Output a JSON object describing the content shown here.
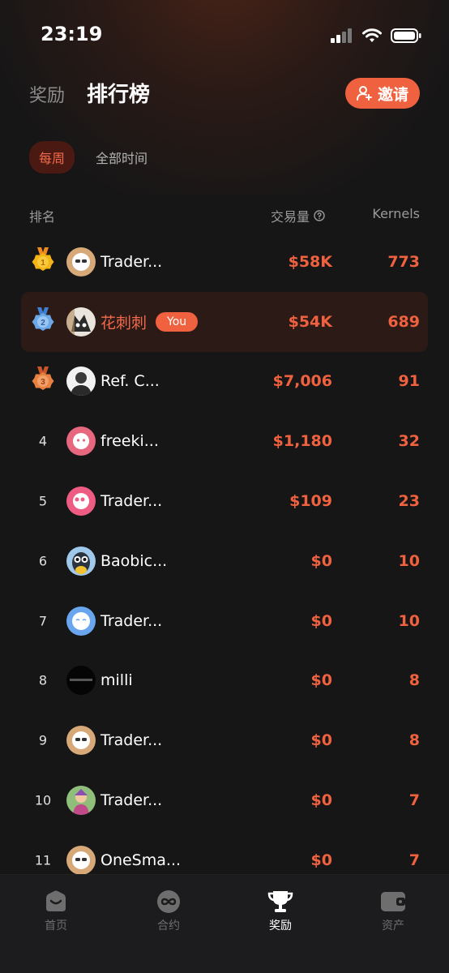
{
  "status_bar": {
    "time": "23:19"
  },
  "header": {
    "tab_rewards": "奖励",
    "tab_leaderboard": "排行榜",
    "invite_label": "邀请"
  },
  "filters": {
    "weekly": "每周",
    "all_time": "全部时间"
  },
  "columns": {
    "rank": "排名",
    "volume": "交易量",
    "kernels": "Kernels"
  },
  "rows": [
    {
      "rank": "1",
      "name": "Trader...",
      "volume": "$58K",
      "kernels": "773"
    },
    {
      "rank": "2",
      "name": "花刺刺",
      "badge": "You",
      "volume": "$54K",
      "kernels": "689"
    },
    {
      "rank": "3",
      "name": "Ref. C...",
      "volume": "$7,006",
      "kernels": "91"
    },
    {
      "rank": "4",
      "name": "freeki...",
      "volume": "$1,180",
      "kernels": "32"
    },
    {
      "rank": "5",
      "name": "Trader...",
      "volume": "$109",
      "kernels": "23"
    },
    {
      "rank": "6",
      "name": "Baobic...",
      "volume": "$0",
      "kernels": "10"
    },
    {
      "rank": "7",
      "name": "Trader...",
      "volume": "$0",
      "kernels": "10"
    },
    {
      "rank": "8",
      "name": "milli",
      "volume": "$0",
      "kernels": "8"
    },
    {
      "rank": "9",
      "name": "Trader...",
      "volume": "$0",
      "kernels": "8"
    },
    {
      "rank": "10",
      "name": "Trader...",
      "volume": "$0",
      "kernels": "7"
    },
    {
      "rank": "11",
      "name": "OneSma...",
      "volume": "$0",
      "kernels": "7"
    }
  ],
  "bottom_nav": [
    {
      "label": "首页",
      "icon": "home-icon"
    },
    {
      "label": "合约",
      "icon": "futures-icon"
    },
    {
      "label": "奖励",
      "icon": "trophy-icon"
    },
    {
      "label": "资产",
      "icon": "wallet-icon"
    }
  ],
  "colors": {
    "accent": "#f0623f",
    "gold": "#f5b416",
    "silver": "#6aa8e8",
    "bronze": "#e8803f"
  }
}
